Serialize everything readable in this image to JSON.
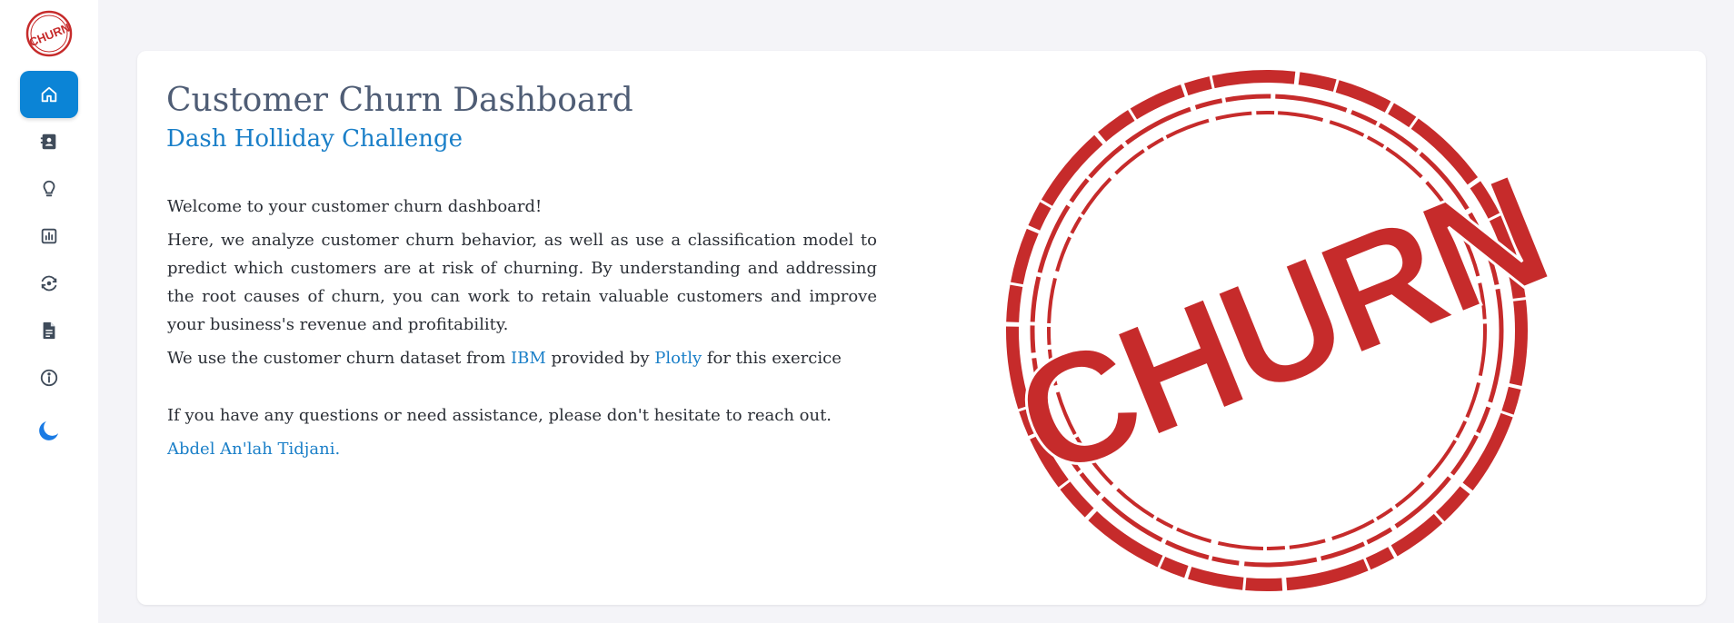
{
  "sidebar": {
    "logo_text": "CHURN",
    "items": [
      {
        "icon": "home-icon",
        "active": true
      },
      {
        "icon": "contact-book-icon",
        "active": false
      },
      {
        "icon": "lightbulb-icon",
        "active": false
      },
      {
        "icon": "bar-chart-icon",
        "active": false
      },
      {
        "icon": "eye-refresh-icon",
        "active": false
      },
      {
        "icon": "document-icon",
        "active": false
      },
      {
        "icon": "info-icon",
        "active": false
      },
      {
        "icon": "moon-icon",
        "active": false
      }
    ]
  },
  "main": {
    "title": "Customer Churn Dashboard",
    "subtitle": "Dash Holliday Challenge",
    "welcome": "Welcome to your customer churn dashboard!",
    "intro": "Here, we analyze customer churn behavior, as well as use a classification model to predict which customers are at risk of churning. By understanding and addressing the root causes of churn, you can work to retain valuable customers and improve your business's revenue and profitability.",
    "dataset_prefix": "We use the customer churn dataset from",
    "dataset_link_ibm": "IBM",
    "dataset_middle": "provided by",
    "dataset_link_plotly": "Plotly",
    "dataset_suffix": "for this exercice",
    "contact_text": "If you have any questions or need assistance, please don't hesitate to reach out.",
    "author_link": "Abdel An'lah Tidjani.",
    "stamp_text": "CHURN"
  },
  "colors": {
    "accent": "#0b84d6",
    "link": "#1a7fc8",
    "stamp_red": "#c62b2b",
    "title": "#4f5d75"
  }
}
